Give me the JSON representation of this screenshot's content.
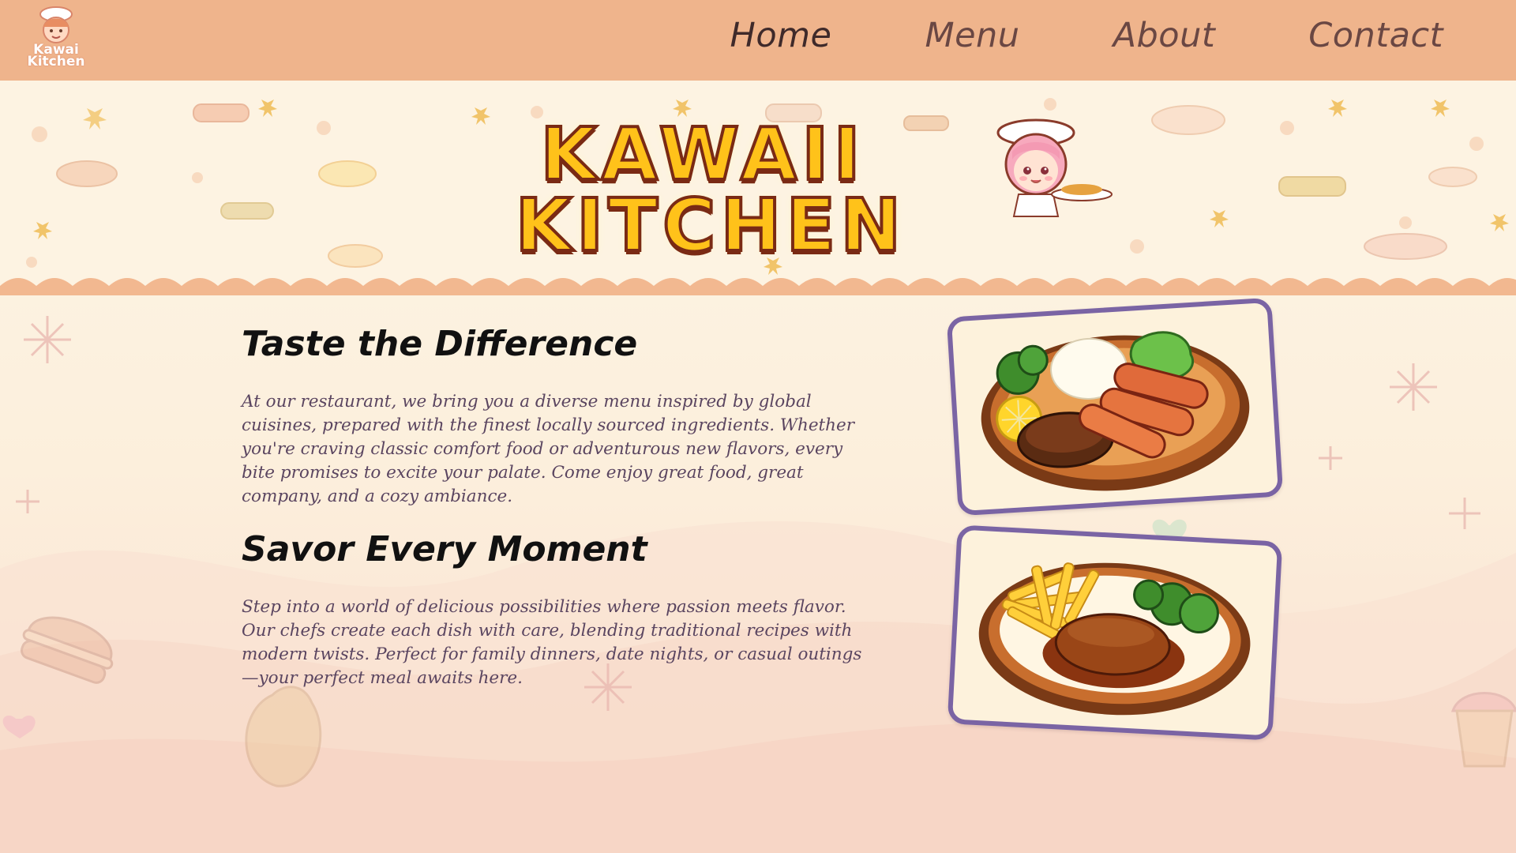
{
  "brand": {
    "logo_small_line1": "Kawai",
    "logo_small_line2": "Kitchen",
    "banner_line1": "KAWAII",
    "banner_line2": "KITCHEN"
  },
  "nav": {
    "items": [
      {
        "label": "Home",
        "active": true
      },
      {
        "label": "Menu",
        "active": false
      },
      {
        "label": "About",
        "active": false
      },
      {
        "label": "Contact",
        "active": false
      }
    ]
  },
  "sections": [
    {
      "title": "Taste the Difference",
      "body": "At our restaurant, we bring you a diverse menu inspired by global cuisines, prepared with the finest locally sourced ingredients. Whether you're craving classic comfort food or adventurous new flavors, every bite promises to excite your palate. Come enjoy great food, great company, and a cozy ambiance.",
      "image_icon": "plate-with-hamburg-steak-sausages-rice-broccoli-icon"
    },
    {
      "title": "Savor Every Moment",
      "body": "Step into a world of delicious possibilities where passion meets flavor. Our chefs create each dish with care, blending traditional recipes with modern twists. Perfect for family dinners, date nights, or casual outings—your perfect meal awaits here.",
      "image_icon": "plate-with-hamburg-steak-fries-broccoli-icon"
    }
  ],
  "colors": {
    "nav_background": "#efb48c",
    "nav_text": "#6a4743",
    "nav_active_text": "#3f2a2a",
    "card_border": "#7a64a4",
    "body_text": "#5a4560",
    "banner_fill": "#ffc21a",
    "banner_outline": "#7a2a14"
  }
}
